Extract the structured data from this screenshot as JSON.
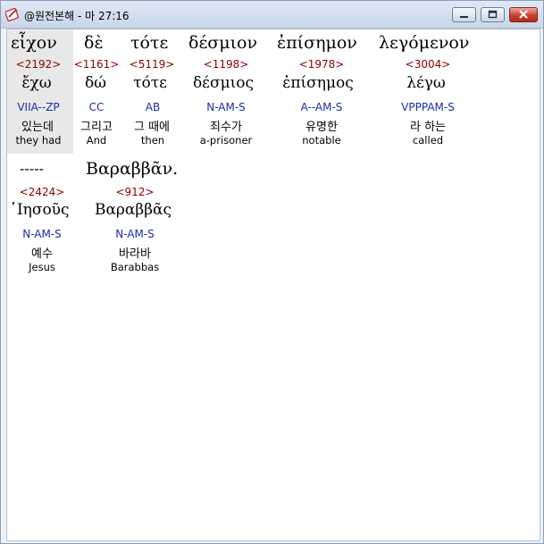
{
  "window": {
    "title": "@원전본해 - 마 27:16"
  },
  "lines": [
    {
      "words": [
        {
          "main": "εἶχον",
          "number": "<2192>",
          "lexeme": "ἔχω",
          "morph": "VIIA--ZP",
          "korean": "있는데",
          "english": "they had"
        },
        {
          "main": "δὲ",
          "number": "<1161>",
          "lexeme": "δώ",
          "morph": "CC",
          "korean": "그리고",
          "english": "And"
        },
        {
          "main": "τότε",
          "number": "<5119>",
          "lexeme": "τότε",
          "morph": "AB",
          "korean": "그 때에",
          "english": "then"
        },
        {
          "main": "δέσμιον",
          "number": "<1198>",
          "lexeme": "δέσμιος",
          "morph": "N-AM-S",
          "korean": "죄수가",
          "english": "a-prisoner"
        },
        {
          "main": "ἐπίσημον",
          "number": "<1978>",
          "lexeme": "ἐπίσημος",
          "morph": "A--AM-S",
          "korean": "유명한",
          "english": "notable"
        },
        {
          "main": "λεγόμενον",
          "number": "<3004>",
          "lexeme": "λέγω",
          "morph": "VPPPAM-S",
          "korean": "라 하는",
          "english": "called"
        }
      ]
    },
    {
      "words": [
        {
          "main": "-----",
          "number": "<2424>",
          "lexeme": "᾿Ιησοῦς",
          "morph": "N-AM-S",
          "korean": "예수",
          "english": "Jesus"
        },
        {
          "main": "Βαραββᾶν.",
          "number": "<912>",
          "lexeme": "Βαραββᾶς",
          "morph": "N-AM-S",
          "korean": "바라바",
          "english": "Barabbas"
        }
      ]
    }
  ]
}
